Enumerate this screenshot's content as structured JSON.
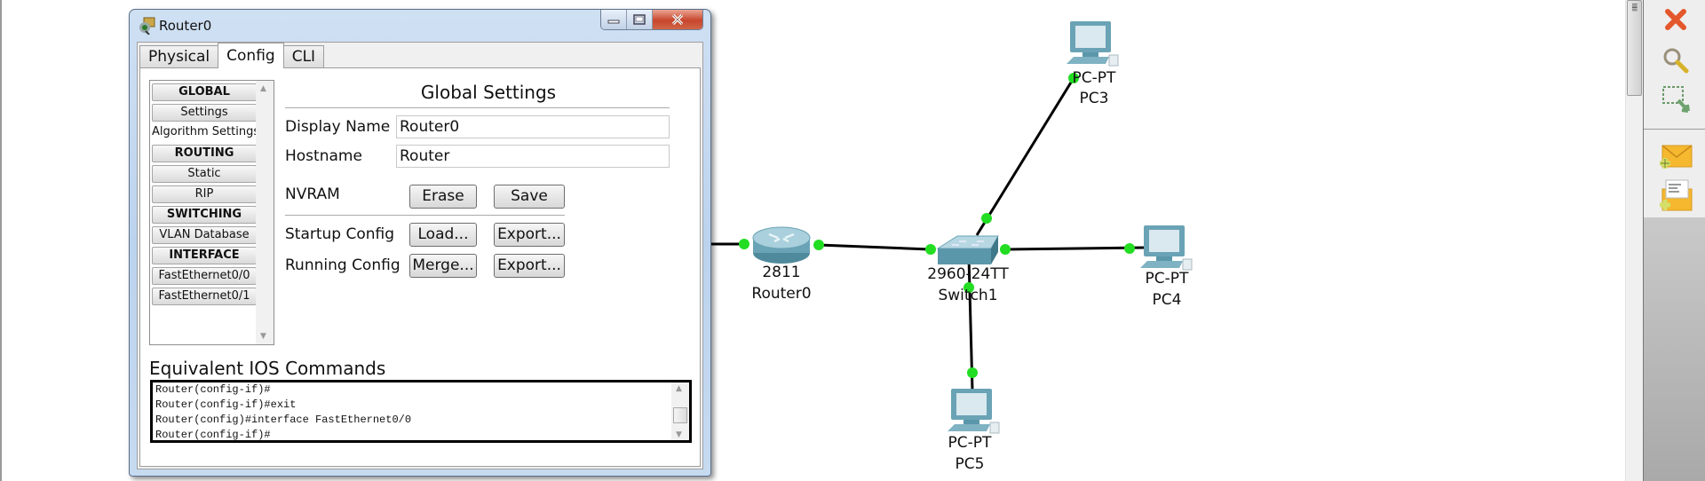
{
  "dialog": {
    "title": "Router0",
    "icon": "router-config-icon",
    "window_buttons": {
      "minimize": "minimize-icon",
      "maximize": "maximize-icon",
      "close": "close-icon"
    },
    "tabs": [
      {
        "label": "Physical",
        "active": false
      },
      {
        "label": "Config",
        "active": true
      },
      {
        "label": "CLI",
        "active": false
      }
    ],
    "sidebar": {
      "items": [
        {
          "label": "GLOBAL",
          "type": "header"
        },
        {
          "label": "Settings",
          "type": "item"
        },
        {
          "label": "Algorithm Settings",
          "type": "item"
        },
        {
          "label": "ROUTING",
          "type": "header"
        },
        {
          "label": "Static",
          "type": "item"
        },
        {
          "label": "RIP",
          "type": "item"
        },
        {
          "label": "SWITCHING",
          "type": "header"
        },
        {
          "label": "VLAN Database",
          "type": "item"
        },
        {
          "label": "INTERFACE",
          "type": "header"
        },
        {
          "label": "FastEthernet0/0",
          "type": "item"
        },
        {
          "label": "FastEthernet0/1",
          "type": "item"
        }
      ]
    },
    "settings": {
      "title": "Global Settings",
      "display_name_label": "Display Name",
      "display_name_value": "Router0",
      "hostname_label": "Hostname",
      "hostname_value": "Router",
      "nvram_label": "NVRAM",
      "erase_label": "Erase",
      "save_label": "Save",
      "startup_label": "Startup Config",
      "load_label": "Load...",
      "startup_export_label": "Export...",
      "running_label": "Running Config",
      "merge_label": "Merge...",
      "running_export_label": "Export..."
    },
    "ios": {
      "title": "Equivalent IOS Commands",
      "lines": [
        "Router(config-if)#",
        "Router(config-if)#exit",
        "Router(config)#interface FastEthernet0/0",
        "Router(config-if)#"
      ]
    }
  },
  "topology": {
    "link_color": "#000000",
    "port_color": "#22dd22",
    "devices": [
      {
        "id": "router0",
        "type": "router",
        "model": "2811",
        "name": "Router0"
      },
      {
        "id": "switch1",
        "type": "switch",
        "model": "2960-24TT",
        "name": "Switch1"
      },
      {
        "id": "pc3",
        "type": "pc",
        "model": "PC-PT",
        "name": "PC3"
      },
      {
        "id": "pc4",
        "type": "pc",
        "model": "PC-PT",
        "name": "PC4"
      },
      {
        "id": "pc5",
        "type": "pc",
        "model": "PC-PT",
        "name": "PC5"
      }
    ],
    "links": [
      {
        "from": "offscreen-left",
        "to": "router0"
      },
      {
        "from": "router0",
        "to": "switch1"
      },
      {
        "from": "switch1",
        "to": "pc3"
      },
      {
        "from": "switch1",
        "to": "pc4"
      },
      {
        "from": "switch1",
        "to": "pc5"
      }
    ]
  },
  "right_toolbar": {
    "tools": [
      {
        "name": "delete",
        "icon": "delete-x-icon"
      },
      {
        "name": "inspect",
        "icon": "magnifier-icon"
      },
      {
        "name": "resize-shape",
        "icon": "resize-select-icon"
      },
      {
        "name": "add-simple-pdu",
        "icon": "add-simple-pdu-icon"
      },
      {
        "name": "add-complex-pdu",
        "icon": "add-complex-pdu-icon"
      }
    ]
  }
}
